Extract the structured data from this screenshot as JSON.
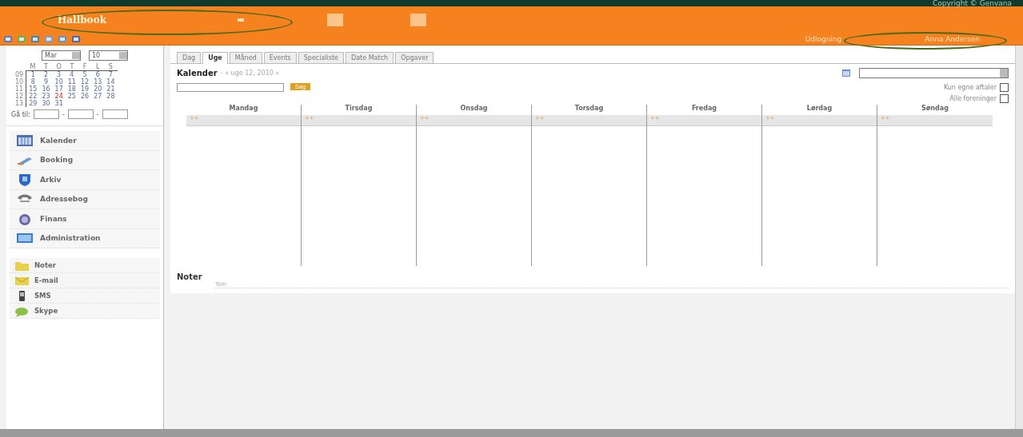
{
  "header": {
    "title": "Hallbook",
    "copyright": "Copyright © Genvana",
    "logout": "Udlogning",
    "user": "Anna Andersen"
  },
  "mini_calendar": {
    "month": "Mar",
    "year": "10",
    "weekdays": [
      "M",
      "T",
      "O",
      "T",
      "F",
      "L",
      "S"
    ],
    "weeks": [
      {
        "week": "09",
        "days": [
          {
            "d": "1",
            "today": false
          },
          {
            "d": "2",
            "today": false
          },
          {
            "d": "3",
            "today": false
          },
          {
            "d": "4",
            "today": false
          },
          {
            "d": "5",
            "today": false
          },
          {
            "d": "6",
            "today": false
          },
          {
            "d": "7",
            "today": false
          }
        ]
      },
      {
        "week": "10",
        "days": [
          {
            "d": "8",
            "today": false
          },
          {
            "d": "9",
            "today": false
          },
          {
            "d": "10",
            "today": false
          },
          {
            "d": "11",
            "today": false
          },
          {
            "d": "12",
            "today": false
          },
          {
            "d": "13",
            "today": false
          },
          {
            "d": "14",
            "today": false
          }
        ]
      },
      {
        "week": "11",
        "days": [
          {
            "d": "15",
            "today": false
          },
          {
            "d": "16",
            "today": false
          },
          {
            "d": "17",
            "today": false
          },
          {
            "d": "18",
            "today": false
          },
          {
            "d": "19",
            "today": false
          },
          {
            "d": "20",
            "today": false
          },
          {
            "d": "21",
            "today": false
          }
        ]
      },
      {
        "week": "12",
        "days": [
          {
            "d": "22",
            "today": false
          },
          {
            "d": "23",
            "today": false
          },
          {
            "d": "24",
            "today": true
          },
          {
            "d": "25",
            "today": false
          },
          {
            "d": "26",
            "today": false
          },
          {
            "d": "27",
            "today": false
          },
          {
            "d": "28",
            "today": false
          }
        ]
      },
      {
        "week": "13",
        "days": [
          {
            "d": "29",
            "today": false
          },
          {
            "d": "30",
            "today": false
          },
          {
            "d": "31",
            "today": false
          }
        ]
      }
    ],
    "goto_label": "Gå til:",
    "goto_separators": [
      "-",
      "-"
    ]
  },
  "nav": [
    {
      "label": "Kalender"
    },
    {
      "label": "Booking"
    },
    {
      "label": "Arkiv"
    },
    {
      "label": "Adressebog"
    },
    {
      "label": "Finans"
    },
    {
      "label": "Administration"
    }
  ],
  "tools": [
    {
      "label": "Noter"
    },
    {
      "label": "E-mail"
    },
    {
      "label": "SMS"
    },
    {
      "label": "Skype"
    }
  ],
  "tabs": [
    {
      "label": "Dag",
      "selected": false
    },
    {
      "label": "Uge",
      "selected": true
    },
    {
      "label": "Måned",
      "selected": false
    },
    {
      "label": "Events",
      "selected": false
    },
    {
      "label": "Specialiste",
      "selected": false
    },
    {
      "label": "Date Match",
      "selected": false
    },
    {
      "label": "Opgaver",
      "selected": false
    }
  ],
  "calendar": {
    "title": "Kalender",
    "period": "- « uge 12, 2010 »",
    "search_button": "Søg",
    "filters": [
      {
        "label": "Kun egne aftaler",
        "checked": false
      },
      {
        "label": "Alle foreninger",
        "checked": false
      }
    ],
    "days": [
      {
        "name": "Mandag",
        "add": "++"
      },
      {
        "name": "Tirsdag",
        "add": "++"
      },
      {
        "name": "Onsdag",
        "add": "++"
      },
      {
        "name": "Torsdag",
        "add": "++"
      },
      {
        "name": "Fredag",
        "add": "++"
      },
      {
        "name": "Lørdag",
        "add": "++"
      },
      {
        "name": "Søndag",
        "add": "++"
      }
    ]
  },
  "notes": {
    "title": "Noter",
    "empty": "Tom"
  }
}
